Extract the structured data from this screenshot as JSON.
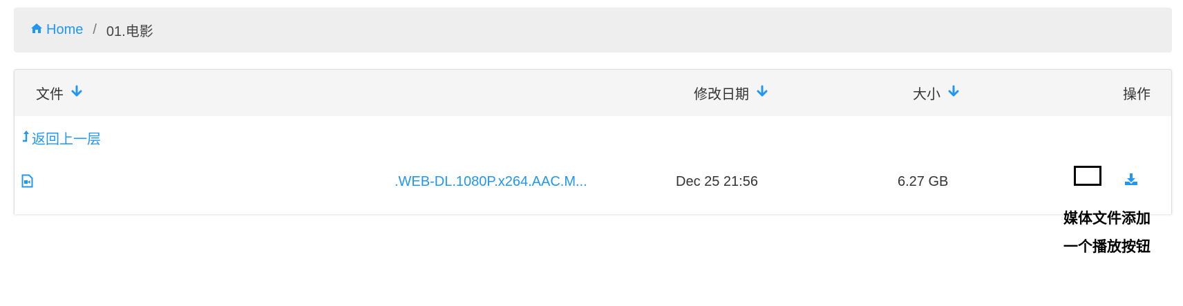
{
  "breadcrumb": {
    "home_label": "Home",
    "separator": "/",
    "current": "01.电影"
  },
  "table": {
    "headers": {
      "file": "文件",
      "date": "修改日期",
      "size": "大小",
      "ops": "操作"
    },
    "back_label": "返回上一层",
    "rows": [
      {
        "name": ".WEB-DL.1080P.x264.AAC.M...",
        "date": "Dec 25 21:56",
        "size": "6.27 GB"
      }
    ]
  },
  "annotation": {
    "line1": "媒体文件添加",
    "line2": "一个播放按钮"
  },
  "colors": {
    "accent": "#2196f3",
    "breadcrumb_bg": "#eeeeee",
    "header_bg": "#f5f5f5"
  },
  "icons": {
    "home": "home-icon",
    "sort": "arrow-down-icon",
    "back": "level-up-icon",
    "file": "video-file-icon",
    "download": "download-icon"
  }
}
